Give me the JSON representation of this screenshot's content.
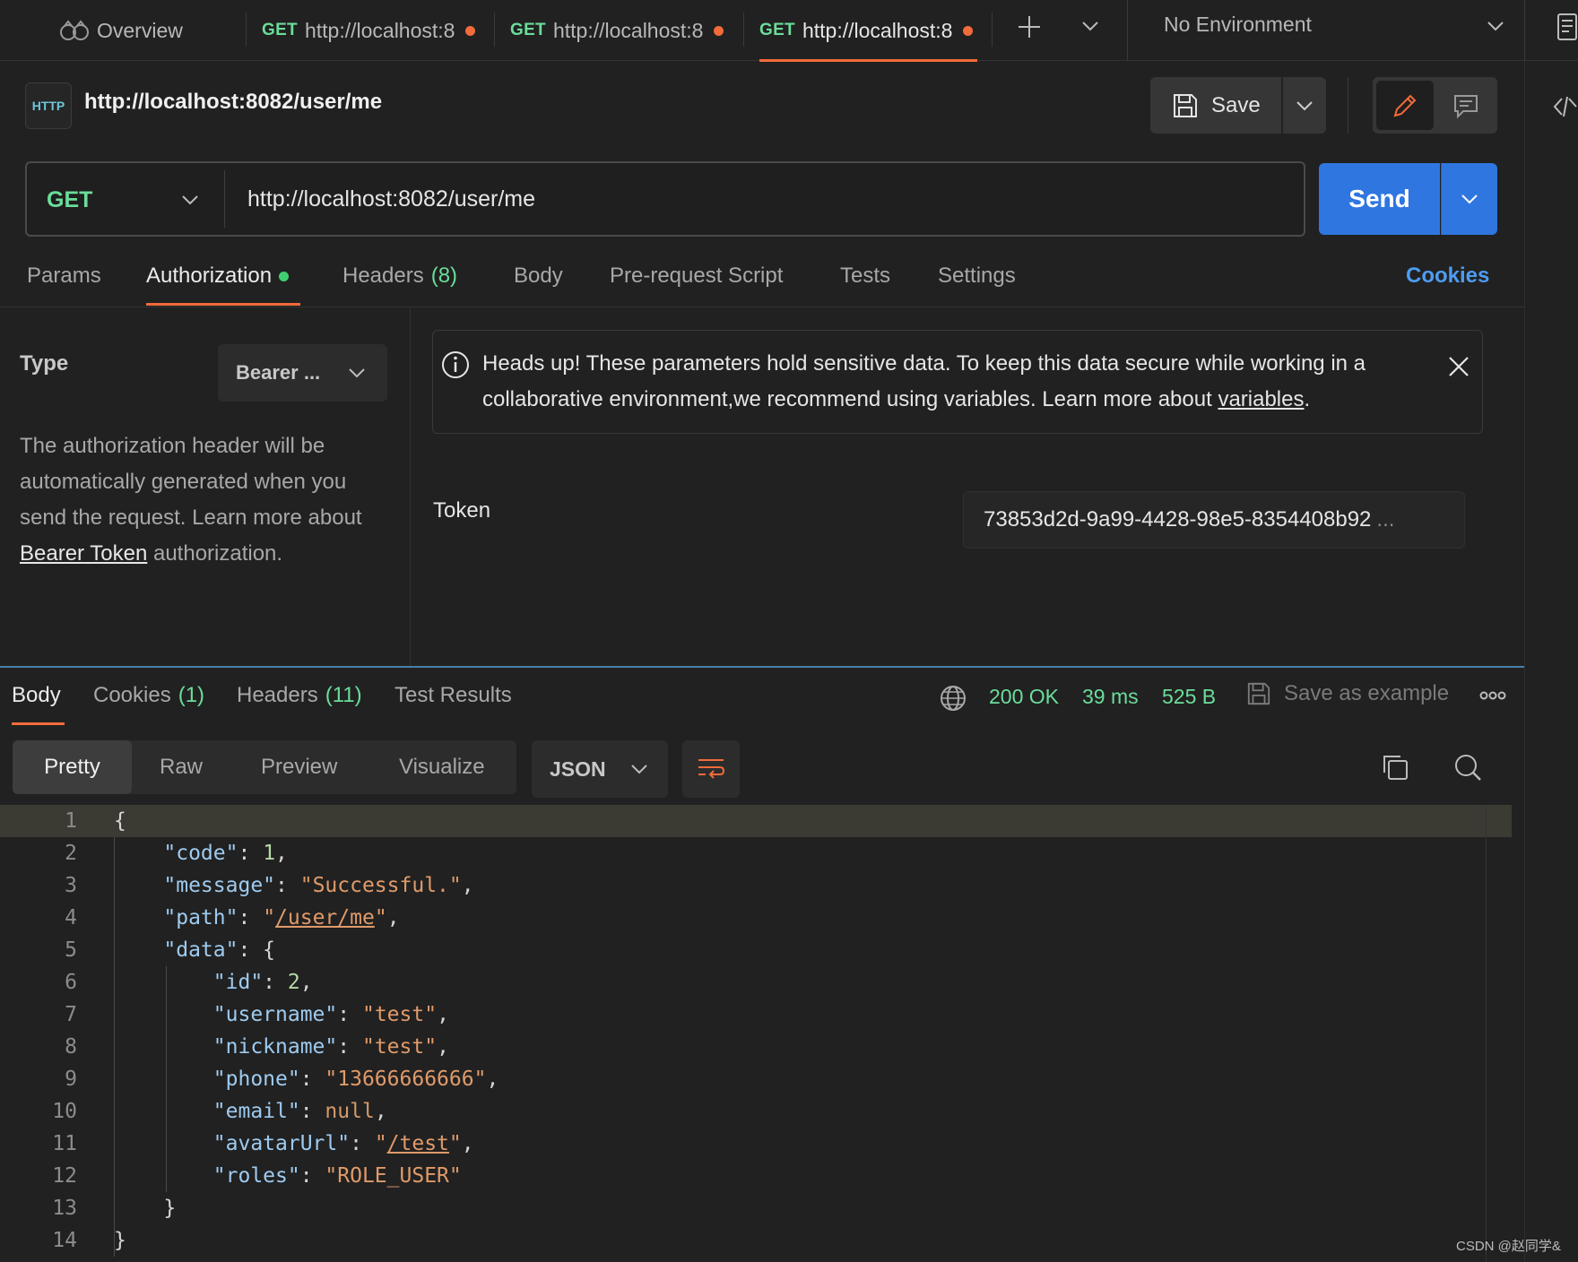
{
  "tabs": [
    {
      "method": "",
      "label": "Overview"
    },
    {
      "method": "GET",
      "label": "http://localhost:8"
    },
    {
      "method": "GET",
      "label": "http://localhost:8"
    },
    {
      "method": "GET",
      "label": "http://localhost:8"
    }
  ],
  "environment": "No Environment",
  "request": {
    "title": "http://localhost:8082/user/me",
    "save_label": "Save",
    "method": "GET",
    "url": "http://localhost:8082/user/me",
    "send_label": "Send"
  },
  "request_tabs": {
    "params": "Params",
    "authorization": "Authorization",
    "headers": "Headers",
    "headers_count": "(8)",
    "body": "Body",
    "prerequest": "Pre-request Script",
    "tests": "Tests",
    "settings": "Settings",
    "cookies": "Cookies"
  },
  "auth": {
    "type_label": "Type",
    "type_value": "Bearer ...",
    "desc_before": "The authorization header will be automatically generated when you send the request. Learn more about ",
    "desc_link": "Bearer Token",
    "desc_after": " authorization.",
    "alert_before": "Heads up! These parameters hold sensitive data. To keep this data secure while working in a collaborative environment,we recommend using variables. Learn more about ",
    "alert_link": "variables",
    "alert_after": ".",
    "token_label": "Token",
    "token_value": "73853d2d-9a99-4428-98e5-8354408b92",
    "token_ellipsis": "..."
  },
  "response_tabs": {
    "body": "Body",
    "cookies": "Cookies",
    "cookies_count": "(1)",
    "headers": "Headers",
    "headers_count": "(11)",
    "test_results": "Test Results"
  },
  "response_status": {
    "status": "200 OK",
    "time": "39 ms",
    "size": "525 B",
    "save_example": "Save as example"
  },
  "view_modes": [
    "Pretty",
    "Raw",
    "Preview",
    "Visualize"
  ],
  "format": "JSON",
  "code_lines": [
    {
      "n": "1"
    },
    {
      "n": "2"
    },
    {
      "n": "3"
    },
    {
      "n": "4"
    },
    {
      "n": "5"
    },
    {
      "n": "6"
    },
    {
      "n": "7"
    },
    {
      "n": "8"
    },
    {
      "n": "9"
    },
    {
      "n": "10"
    },
    {
      "n": "11"
    },
    {
      "n": "12"
    },
    {
      "n": "13"
    },
    {
      "n": "14"
    }
  ],
  "json_body": {
    "code_key": "\"code\"",
    "code_val": "1",
    "message_key": "\"message\"",
    "message_val": "\"Successful.\"",
    "path_key": "\"path\"",
    "path_val": "/user/me",
    "data_key": "\"data\"",
    "id_key": "\"id\"",
    "id_val": "2",
    "username_key": "\"username\"",
    "username_val": "\"test\"",
    "nickname_key": "\"nickname\"",
    "nickname_val": "\"test\"",
    "phone_key": "\"phone\"",
    "phone_val": "\"13666666666\"",
    "email_key": "\"email\"",
    "email_val": "null",
    "avatar_key": "\"avatarUrl\"",
    "avatar_val": "/test",
    "roles_key": "\"roles\"",
    "roles_val": "\"ROLE_USER\""
  },
  "watermark": "CSDN @赵同学&",
  "colors": {
    "accent": "#f26b3a",
    "send": "#2f76e0",
    "method": "#6bdd9a",
    "link": "#4d9cf0"
  }
}
